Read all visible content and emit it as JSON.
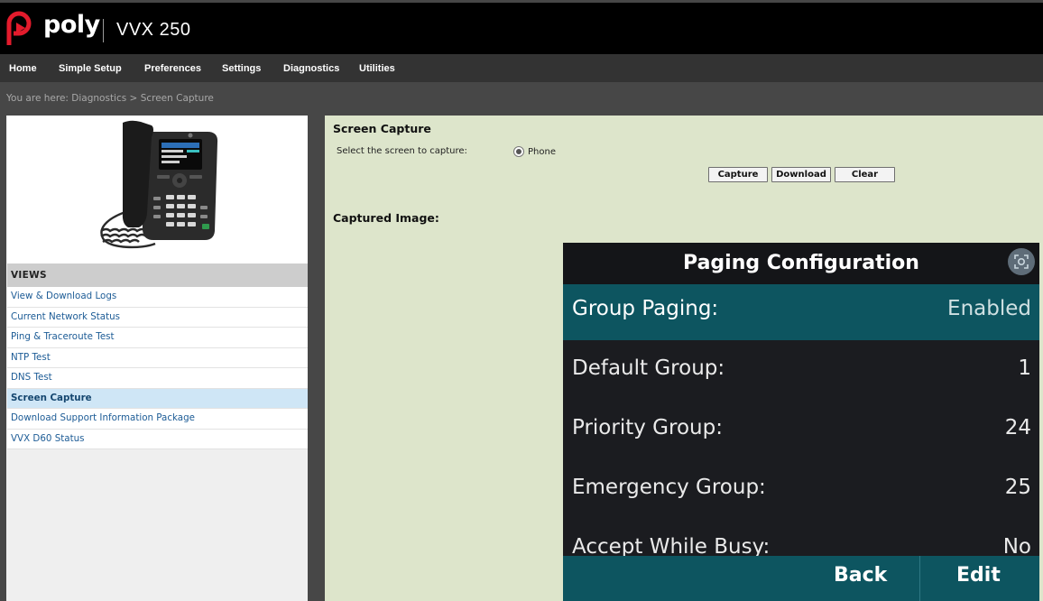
{
  "brand": {
    "logo_text": "poly",
    "model": "VVX 250",
    "accent": "#e31b2c"
  },
  "nav": [
    "Home",
    "Simple Setup",
    "Preferences",
    "Settings",
    "Diagnostics",
    "Utilities"
  ],
  "breadcrumb": "You are here: Diagnostics > Screen Capture",
  "views": {
    "header": "VIEWS",
    "items": [
      "View & Download Logs",
      "Current Network Status",
      "Ping & Traceroute Test",
      "NTP Test",
      "DNS Test",
      "Screen Capture",
      "Download Support Information Package",
      "VVX D60 Status"
    ],
    "active": "Screen Capture"
  },
  "main": {
    "title": "Screen Capture",
    "select_label": "Select the screen to capture:",
    "radio_label": "Phone",
    "buttons": {
      "capture": "Capture",
      "download": "Download",
      "clear": "Clear"
    },
    "captured_label": "Captured Image:"
  },
  "screenshot": {
    "title": "Paging Configuration",
    "rows": [
      {
        "label": "Group Paging:",
        "value": "Enabled"
      },
      {
        "label": "Default Group:",
        "value": "1"
      },
      {
        "label": "Priority Group:",
        "value": "24"
      },
      {
        "label": "Emergency Group:",
        "value": "25"
      },
      {
        "label": "Accept While Busy:",
        "value": "No"
      }
    ],
    "softkeys": {
      "back": "Back",
      "edit": "Edit"
    }
  }
}
